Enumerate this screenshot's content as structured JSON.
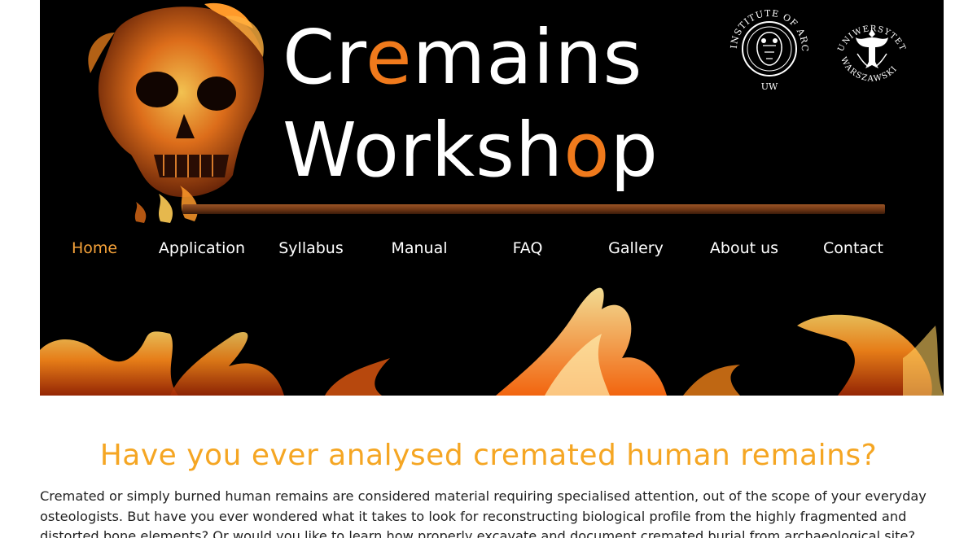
{
  "site": {
    "brand_line1_pre": "Cr",
    "brand_line1_accent": "e",
    "brand_line1_post": "mains",
    "brand_line2_pre": "Worksh",
    "brand_line2_accent": "o",
    "brand_line2_post": "p",
    "logos": {
      "institute_seal_text": "INSTITUTE OF ARCHAEOLOGY",
      "institute_seal_abbr": "UW",
      "university_seal_top": "UNIWERSYTET",
      "university_seal_bottom": "WARSZAWSKI"
    }
  },
  "nav": {
    "items": [
      {
        "label": "Home",
        "active": true
      },
      {
        "label": "Application",
        "active": false
      },
      {
        "label": "Syllabus",
        "active": false
      },
      {
        "label": "Manual",
        "active": false
      },
      {
        "label": "FAQ",
        "active": false
      },
      {
        "label": "Gallery",
        "active": false
      },
      {
        "label": "About us",
        "active": false
      },
      {
        "label": "Contact",
        "active": false
      }
    ]
  },
  "main": {
    "heading": "Have you ever analysed cremated human remains?",
    "intro": "Cremated or simply burned human remains are considered material requiring specialised attention, out of the scope of your everyday osteologists. But have you ever wondered what it takes to look for reconstructing biological profile from the highly fragmented and distorted bone elements? Or would you like to learn how properly excavate and document cremated burial from archaeological site?"
  },
  "colors": {
    "accent_orange": "#f07a1c",
    "heading_orange": "#f5a623",
    "nav_active": "#f7a33a",
    "banner_bg": "#000000"
  }
}
